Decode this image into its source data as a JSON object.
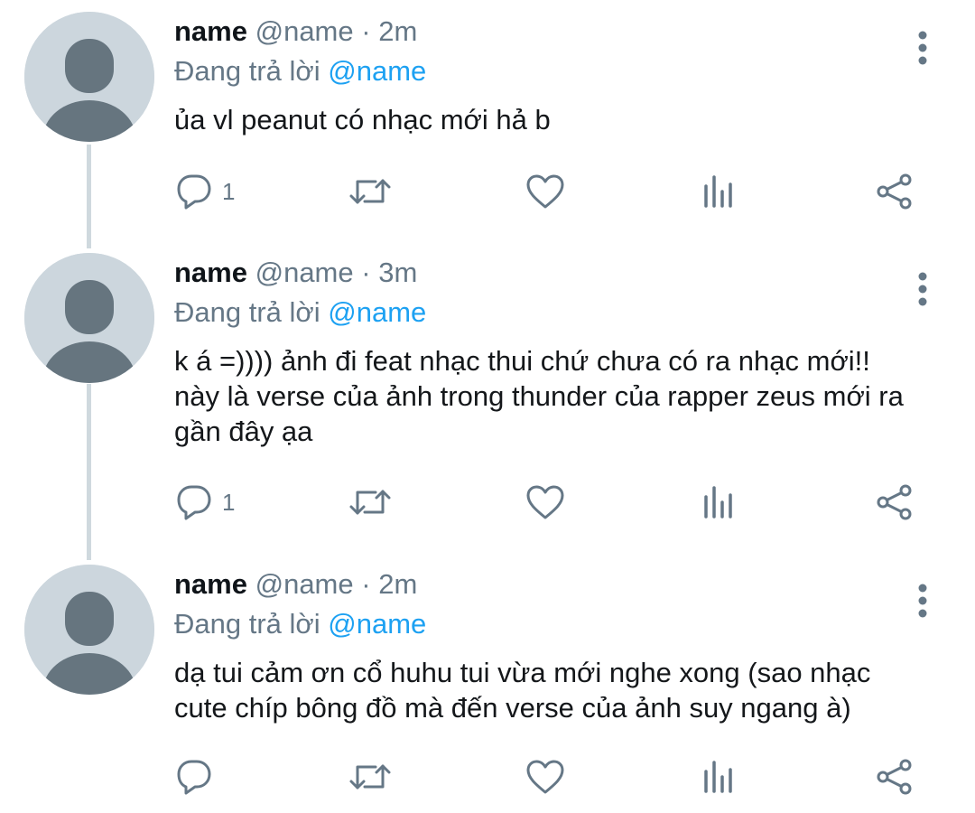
{
  "tweets": [
    {
      "author": "name",
      "handle": "@name",
      "separator": "·",
      "time": "2m",
      "reply_prefix": "Đang trả lời",
      "reply_handle": "@name",
      "text_lines": [
        "ủa vl peanut có nhạc mới hả b"
      ],
      "reply_count": "1"
    },
    {
      "author": "name",
      "handle": "@name",
      "separator": "·",
      "time": "3m",
      "reply_prefix": "Đang trả lời",
      "reply_handle": "@name",
      "text_lines": [
        "k á =)))) ảnh đi feat nhạc thui chứ chưa có ra nhạc mới!!",
        "này là verse của ảnh trong thunder của rapper zeus mới ra",
        "gần đây ạa"
      ],
      "reply_count": "1"
    },
    {
      "author": "name",
      "handle": "@name",
      "separator": "·",
      "time": "2m",
      "reply_prefix": "Đang trả lời",
      "reply_handle": "@name",
      "text_lines": [
        "dạ tui cảm ơn cổ huhu tui vừa mới nghe xong (sao nhạc",
        "cute chíp bông đồ mà đến verse của ảnh suy ngang à)"
      ],
      "reply_count": ""
    }
  ],
  "icons": {
    "more": "more-vertical-icon",
    "reply": "reply-icon",
    "retweet": "retweet-icon",
    "like": "like-icon",
    "analytics": "analytics-icon",
    "share": "share-icon"
  },
  "colors": {
    "accent": "#1da1f2",
    "secondary_text": "#657786",
    "avatar_bg": "#ccd6dd",
    "avatar_fg": "#66757f",
    "thread_line": "#cfd9de"
  }
}
